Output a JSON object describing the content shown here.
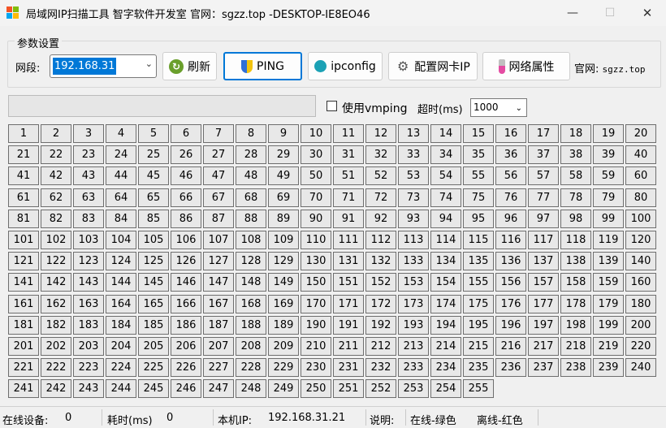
{
  "window": {
    "title": "局域网IP扫描工具 智字软件开发室 官网：sgzz.top   -DESKTOP-IE8EO46",
    "min_glyph": "—",
    "max_glyph": "☐",
    "close_glyph": "✕"
  },
  "settings": {
    "group_label": "参数设置",
    "segment_label": "网段:",
    "segment_value": "192.168.31",
    "buttons": {
      "refresh": "刷新",
      "ping": "PING",
      "ipconfig": "ipconfig",
      "config_nic_ip": "配置网卡IP",
      "net_props": "网络属性"
    },
    "site_label": "官网:",
    "site_value": "sgzz.top"
  },
  "options": {
    "vmping_label": "使用vmping",
    "vmping_checked": false,
    "timeout_label": "超时(ms)",
    "timeout_value": "1000",
    "progress": 0
  },
  "ip_grid": {
    "start": 1,
    "end": 255,
    "columns": 20
  },
  "status": {
    "online_label": "在线设备:",
    "online_value": "0",
    "elapsed_label": "耗时(ms)",
    "elapsed_value": "0",
    "local_ip_label": "本机IP:",
    "local_ip_value": "192.168.31.21",
    "legend_label": "说明:",
    "legend_online": "在线-绿色",
    "legend_offline": "离线-红色"
  },
  "colors": {
    "accent": "#0078d7",
    "cell_bg": "#e8e8e8"
  }
}
